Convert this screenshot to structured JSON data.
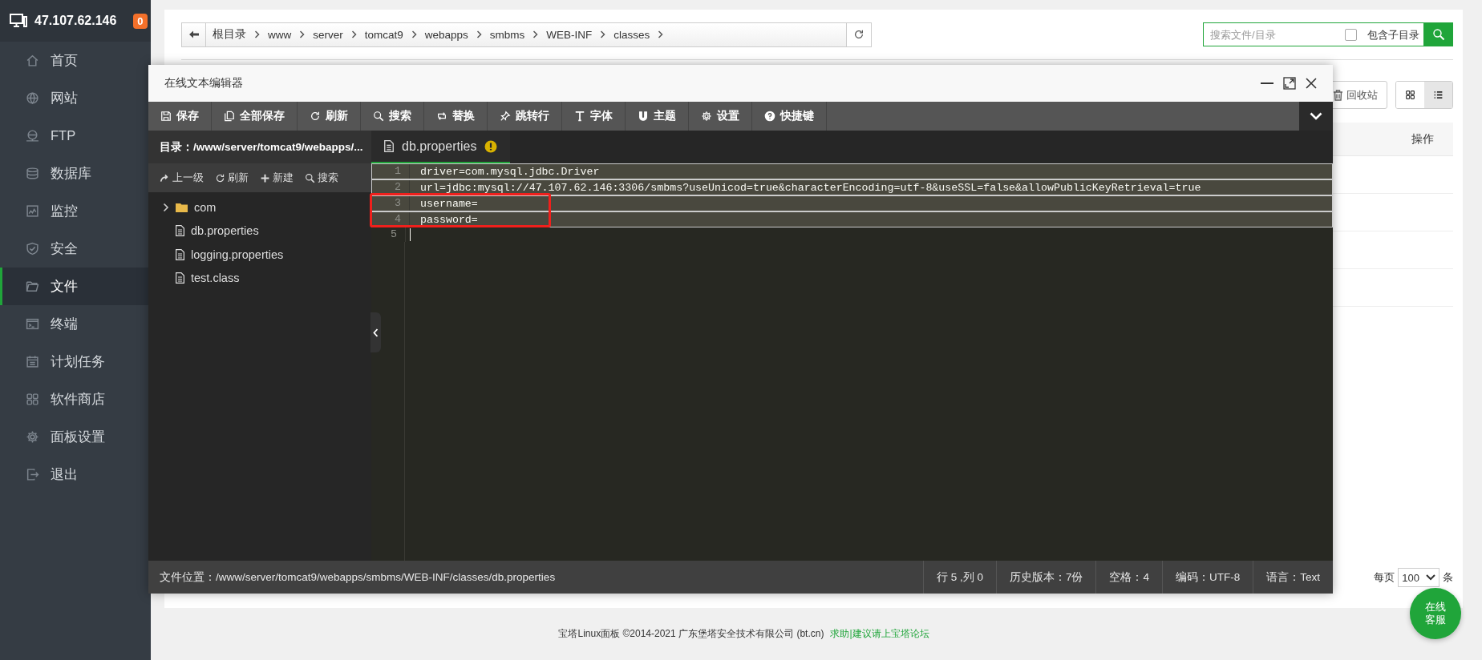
{
  "sidebar": {
    "server_ip": "47.107.62.146",
    "badge": "0",
    "items": [
      {
        "label": "首页",
        "kind": "home",
        "selected": false
      },
      {
        "label": "网站",
        "kind": "globe",
        "selected": false
      },
      {
        "label": "FTP",
        "kind": "ftp",
        "selected": false
      },
      {
        "label": "数据库",
        "kind": "database",
        "selected": false
      },
      {
        "label": "监控",
        "kind": "monitor",
        "selected": false
      },
      {
        "label": "安全",
        "kind": "shield",
        "selected": false
      },
      {
        "label": "文件",
        "kind": "folder",
        "selected": true
      },
      {
        "label": "终端",
        "kind": "terminal",
        "selected": false
      },
      {
        "label": "计划任务",
        "kind": "calendar",
        "selected": false
      },
      {
        "label": "软件商店",
        "kind": "apps",
        "selected": false
      },
      {
        "label": "面板设置",
        "kind": "gear",
        "selected": false
      },
      {
        "label": "退出",
        "kind": "logout",
        "selected": false
      }
    ]
  },
  "breadcrumb": {
    "segments": [
      "根目录",
      "www",
      "server",
      "tomcat9",
      "webapps",
      "smbms",
      "WEB-INF",
      "classes"
    ]
  },
  "search": {
    "placeholder": "搜索文件/目录",
    "include_subdirs": {
      "label": "包含子目录",
      "checked": false
    }
  },
  "recycle_button": {
    "label": "回收站"
  },
  "view_toggle": [
    {
      "kind": "grid",
      "selected": false
    },
    {
      "kind": "list",
      "selected": true
    }
  ],
  "file_table": {
    "columns": [
      "操作"
    ]
  },
  "pagination": {
    "per_page_label": "每页",
    "per_page": "100",
    "unit": "条"
  },
  "editor": {
    "title": "在线文本编辑器",
    "toolbar": [
      {
        "label": "保存",
        "kind": "save"
      },
      {
        "label": "全部保存",
        "kind": "save-all"
      },
      {
        "label": "刷新",
        "kind": "refresh"
      },
      {
        "label": "搜索",
        "kind": "search"
      },
      {
        "label": "替换",
        "kind": "replace"
      },
      {
        "label": "跳转行",
        "kind": "goto"
      },
      {
        "label": "字体",
        "kind": "font"
      },
      {
        "label": "主题",
        "kind": "theme"
      },
      {
        "label": "设置",
        "kind": "settings"
      },
      {
        "label": "快捷键",
        "kind": "help"
      }
    ],
    "directory": "目录：/www/server/tomcat9/webapps/...",
    "dir_actions": [
      {
        "label": "上一级",
        "kind": "up"
      },
      {
        "label": "刷新",
        "kind": "refresh"
      },
      {
        "label": "新建",
        "kind": "new"
      },
      {
        "label": "搜索",
        "kind": "search"
      }
    ],
    "tree": [
      {
        "name": "com",
        "kind": "folder",
        "expanded": false
      },
      {
        "name": "db.properties",
        "kind": "file"
      },
      {
        "name": "logging.properties",
        "kind": "file"
      },
      {
        "name": "test.class",
        "kind": "file"
      }
    ],
    "tab": {
      "name": "db.properties",
      "unsaved": true,
      "selected": true
    },
    "lines": [
      {
        "number": "1",
        "text": "driver=com.mysql.jdbc.Driver",
        "selected": true,
        "cursor": false
      },
      {
        "number": "2",
        "text": "url=jdbc:mysql://47.107.62.146:3306/smbms?useUnicod=true&characterEncoding=utf-8&useSSL=false&allowPublicKeyRetrieval=true",
        "selected": true,
        "cursor": false
      },
      {
        "number": "3",
        "text": "username=",
        "selected": true,
        "cursor": false
      },
      {
        "number": "4",
        "text": "password=",
        "selected": true,
        "cursor": false
      },
      {
        "number": "5",
        "selected": false,
        "cursor": true
      }
    ],
    "status": {
      "path": "文件位置：/www/server/tomcat9/webapps/smbms/WEB-INF/classes/db.properties",
      "items": [
        "行 5 ,列 0",
        "历史版本：7份",
        "空格：4",
        "编码：UTF-8",
        "语言：Text"
      ]
    }
  },
  "chat_button": {
    "lines": [
      "在线",
      "客服"
    ]
  },
  "footer": {
    "copyright": "宝塔Linux面板 ©2014-2021 广东堡塔安全技术有限公司 (bt.cn)",
    "link": "求助|建议请上宝塔论坛"
  }
}
